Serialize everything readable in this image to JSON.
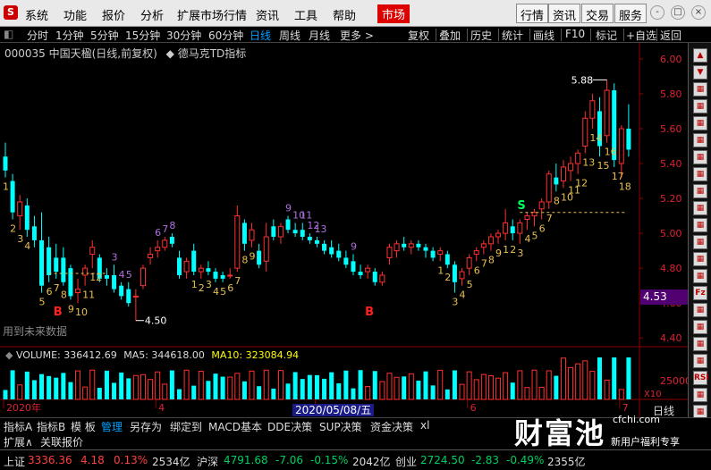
{
  "menubar": {
    "logo": "S",
    "items": [
      "系统",
      "功能",
      "报价",
      "分析",
      "扩展市场行情",
      "资讯",
      "工具",
      "帮助"
    ],
    "active": "市场",
    "right_buttons": [
      "行情",
      "资讯",
      "交易",
      "服务"
    ],
    "window_controls": [
      "-",
      "□",
      "×"
    ]
  },
  "toolbar": {
    "left": [
      "分时",
      "1分钟",
      "5分钟",
      "15分钟",
      "30分钟",
      "60分钟",
      "日线",
      "周线",
      "月线",
      "更多 >"
    ],
    "active": "日线",
    "right": [
      "复权",
      "叠加",
      "历史",
      "统计",
      "画线",
      "F10",
      "标记",
      "+自选",
      "返回"
    ]
  },
  "chart_title": {
    "stock": "000035 中国天楹(日线,前复权)",
    "indicator": "德马克TD指标"
  },
  "price_axis": [
    "6.00",
    "5.80",
    "5.60",
    "5.40",
    "5.20",
    "5.00",
    "4.80",
    "4.60",
    "4.40"
  ],
  "price_tag": "4.53",
  "max_label": "5.88",
  "min_label": "4.50",
  "future_note": "用到未来数据",
  "date_axis": [
    "2020年",
    "4",
    "5",
    "6",
    "7"
  ],
  "date_highlight": "2020/05/08/五",
  "x_day_label": "日线",
  "volume": {
    "label": "VOLUME: 336412.69",
    "ma5": "MA5: 344618.00",
    "ma10": "MA10: 323084.94",
    "axis": [
      "25000",
      "X10"
    ]
  },
  "td_labels": {
    "yellow": [
      "1",
      "2",
      "3",
      "4",
      "5",
      "6",
      "7",
      "8",
      "9",
      "10",
      "11",
      "12",
      "1",
      "2",
      "3",
      "4",
      "5",
      "6",
      "7",
      "8",
      "9",
      "1",
      "2",
      "3",
      "4",
      "5",
      "6",
      "7",
      "8",
      "9",
      "1",
      "2",
      "3",
      "4",
      "5",
      "6",
      "7",
      "8",
      "10",
      "11",
      "12",
      "13",
      "14",
      "15",
      "16",
      "17",
      "18",
      "19"
    ],
    "purple": [
      "3",
      "4",
      "5",
      "6",
      "7",
      "8",
      "9",
      "10",
      "11",
      "12",
      "13",
      "9"
    ],
    "markers": [
      "B",
      "B",
      "S"
    ]
  },
  "tabs1": [
    "指标A",
    "指标B",
    "模 板",
    "管理",
    "另存为",
    "绑定到",
    "MACD基本",
    "DDE决策",
    "SUP决策",
    "资金决策",
    "xl"
  ],
  "tabs1_active": "管理",
  "tabs2": [
    "扩展∧",
    "关联报价"
  ],
  "status": {
    "sh_name": "上证",
    "sh_val": "3336.36",
    "sh_chg": "4.18",
    "sh_pct": "0.13%",
    "sh_amt": "2534亿",
    "sz_name": "沪深",
    "sz_val": "4791.68",
    "sz_chg": "-7.06",
    "sz_pct": "-0.15%",
    "sz_amt": "2042亿",
    "cy_name": "创业",
    "cy_val": "2724.50",
    "cy_chg": "-2.83",
    "cy_pct": "-0.49%",
    "cy_amt": "2355亿"
  },
  "watermark": {
    "big": "财富池",
    "domain": "cfchi.com",
    "sub": "新用户福利专享"
  },
  "sidebar_icons": [
    "▲",
    "▼",
    "▦",
    "▦",
    "▦",
    "▦",
    "▦",
    "▦",
    "▦",
    "▦",
    "▦",
    "▦",
    "▦",
    "▦",
    "Fz",
    "▦",
    "▦",
    "▦",
    "▦",
    "RSI",
    "▦",
    "▦",
    "▦"
  ],
  "chart_data": {
    "type": "candlestick",
    "title": "000035 中国天楹(日线,前复权)",
    "ylim": [
      4.35,
      6.02
    ],
    "candles": [
      [
        5.44,
        5.52,
        5.32,
        5.36
      ],
      [
        5.3,
        5.34,
        5.08,
        5.12
      ],
      [
        5.1,
        5.22,
        5.02,
        5.18
      ],
      [
        5.16,
        5.2,
        4.98,
        5.02
      ],
      [
        5.04,
        5.1,
        4.92,
        4.96
      ],
      [
        4.96,
        5.12,
        4.66,
        4.7
      ],
      [
        4.92,
        4.98,
        4.72,
        4.76
      ],
      [
        4.86,
        4.94,
        4.74,
        4.78
      ],
      [
        4.86,
        4.92,
        4.7,
        4.72
      ],
      [
        4.8,
        4.82,
        4.62,
        4.64
      ],
      [
        4.66,
        4.74,
        4.6,
        4.68
      ],
      [
        4.76,
        4.82,
        4.7,
        4.8
      ],
      [
        4.88,
        4.96,
        4.8,
        4.92
      ],
      [
        4.86,
        4.88,
        4.72,
        4.74
      ],
      [
        4.76,
        4.8,
        4.7,
        4.74
      ],
      [
        4.76,
        4.82,
        4.66,
        4.68
      ],
      [
        4.7,
        4.72,
        4.62,
        4.64
      ],
      [
        4.68,
        4.72,
        4.58,
        4.6
      ],
      [
        4.64,
        4.68,
        4.5,
        4.64
      ],
      [
        4.7,
        4.82,
        4.68,
        4.8
      ],
      [
        4.86,
        4.92,
        4.82,
        4.88
      ],
      [
        4.9,
        4.96,
        4.86,
        4.92
      ],
      [
        4.92,
        4.98,
        4.9,
        4.96
      ],
      [
        4.98,
        5.0,
        4.92,
        4.94
      ],
      [
        4.86,
        4.9,
        4.74,
        4.76
      ],
      [
        4.78,
        4.86,
        4.74,
        4.84
      ],
      [
        4.9,
        4.94,
        4.76,
        4.78
      ],
      [
        4.78,
        4.82,
        4.74,
        4.8
      ],
      [
        4.8,
        4.84,
        4.76,
        4.78
      ],
      [
        4.78,
        4.8,
        4.72,
        4.74
      ],
      [
        4.76,
        4.78,
        4.72,
        4.74
      ],
      [
        4.76,
        4.8,
        4.74,
        4.76
      ],
      [
        4.8,
        5.16,
        4.78,
        5.1
      ],
      [
        5.06,
        5.08,
        4.9,
        4.94
      ],
      [
        4.96,
        5.06,
        4.92,
        5.02
      ],
      [
        4.9,
        4.94,
        4.8,
        4.82
      ],
      [
        4.84,
        5.06,
        4.78,
        4.98
      ],
      [
        5.04,
        5.08,
        4.96,
        4.98
      ],
      [
        4.98,
        5.06,
        4.94,
        5.04
      ],
      [
        5.08,
        5.1,
        5.0,
        5.02
      ],
      [
        5.02,
        5.06,
        4.98,
        5.0
      ],
      [
        5.02,
        5.06,
        4.96,
        4.98
      ],
      [
        4.98,
        5.0,
        4.94,
        4.96
      ],
      [
        4.96,
        4.98,
        4.92,
        4.94
      ],
      [
        4.94,
        4.96,
        4.88,
        4.9
      ],
      [
        4.92,
        4.96,
        4.86,
        4.88
      ],
      [
        4.9,
        4.94,
        4.84,
        4.86
      ],
      [
        4.86,
        4.9,
        4.8,
        4.82
      ],
      [
        4.84,
        4.88,
        4.76,
        4.78
      ],
      [
        4.78,
        4.82,
        4.74,
        4.76
      ],
      [
        4.78,
        4.82,
        4.74,
        4.8
      ],
      [
        4.78,
        4.8,
        4.7,
        4.72
      ],
      [
        4.72,
        4.78,
        4.7,
        4.76
      ],
      [
        4.86,
        4.94,
        4.82,
        4.92
      ],
      [
        4.9,
        4.96,
        4.86,
        4.94
      ],
      [
        4.94,
        4.98,
        4.9,
        4.92
      ],
      [
        4.92,
        4.96,
        4.88,
        4.94
      ],
      [
        4.94,
        4.96,
        4.9,
        4.92
      ],
      [
        4.92,
        4.94,
        4.86,
        4.9
      ],
      [
        4.9,
        4.92,
        4.84,
        4.86
      ],
      [
        4.88,
        4.92,
        4.84,
        4.9
      ],
      [
        4.88,
        4.9,
        4.8,
        4.82
      ],
      [
        4.82,
        4.84,
        4.66,
        4.72
      ],
      [
        4.74,
        4.8,
        4.7,
        4.78
      ],
      [
        4.8,
        4.88,
        4.76,
        4.86
      ],
      [
        4.88,
        4.92,
        4.84,
        4.9
      ],
      [
        4.92,
        4.96,
        4.88,
        4.94
      ],
      [
        4.94,
        5.0,
        4.9,
        4.98
      ],
      [
        4.98,
        5.02,
        4.94,
        5.0
      ],
      [
        5.0,
        5.14,
        4.96,
        5.06
      ],
      [
        5.04,
        5.08,
        4.96,
        5.0
      ],
      [
        5.0,
        5.08,
        4.94,
        5.06
      ],
      [
        5.08,
        5.12,
        5.02,
        5.1
      ],
      [
        5.1,
        5.14,
        5.04,
        5.12
      ],
      [
        5.14,
        5.2,
        5.08,
        5.18
      ],
      [
        5.18,
        5.36,
        5.14,
        5.34
      ],
      [
        5.32,
        5.4,
        5.24,
        5.28
      ],
      [
        5.3,
        5.42,
        5.26,
        5.38
      ],
      [
        5.36,
        5.44,
        5.3,
        5.4
      ],
      [
        5.4,
        5.48,
        5.34,
        5.46
      ],
      [
        5.5,
        5.7,
        5.46,
        5.66
      ],
      [
        5.66,
        5.8,
        5.6,
        5.76
      ],
      [
        5.7,
        5.78,
        5.44,
        5.5
      ],
      [
        5.56,
        5.88,
        5.52,
        5.82
      ],
      [
        5.82,
        5.86,
        5.38,
        5.42
      ],
      [
        5.4,
        5.62,
        5.32,
        5.6
      ],
      [
        5.6,
        5.74,
        5.44,
        5.48
      ]
    ]
  }
}
